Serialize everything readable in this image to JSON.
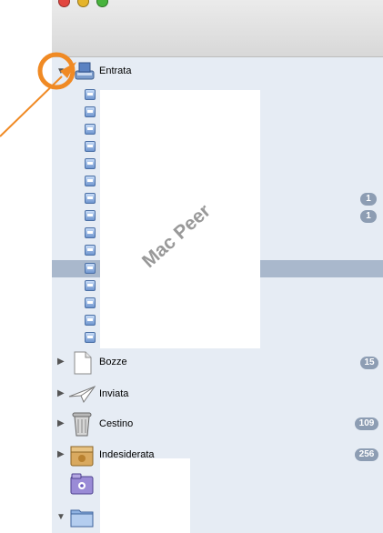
{
  "window": {
    "traffic_lights": [
      "#e2463f",
      "#e5b42a",
      "#48b33d"
    ]
  },
  "mailboxes": {
    "inbox": {
      "label": "Entrata",
      "icon": "inbox-tray-icon",
      "expanded": true
    },
    "drafts": {
      "label": "Bozze",
      "icon": "document-icon",
      "count": "15"
    },
    "sent": {
      "label": "Inviata",
      "icon": "paper-plane-icon",
      "count": ""
    },
    "trash": {
      "label": "Cestino",
      "icon": "trash-icon",
      "count": "109"
    },
    "junk": {
      "label": "Indesiderata",
      "icon": "junk-box-icon",
      "count": "256"
    }
  },
  "subaccounts": {
    "badges": [
      "1",
      "1"
    ]
  },
  "watermark": {
    "text": "Mac Peer"
  },
  "annotation": {
    "color": "#f08a24"
  },
  "colors": {
    "sidebar_bg": "#e6ecf4",
    "selected_row": "#a9b8cc",
    "badge": "#8d9db3"
  }
}
